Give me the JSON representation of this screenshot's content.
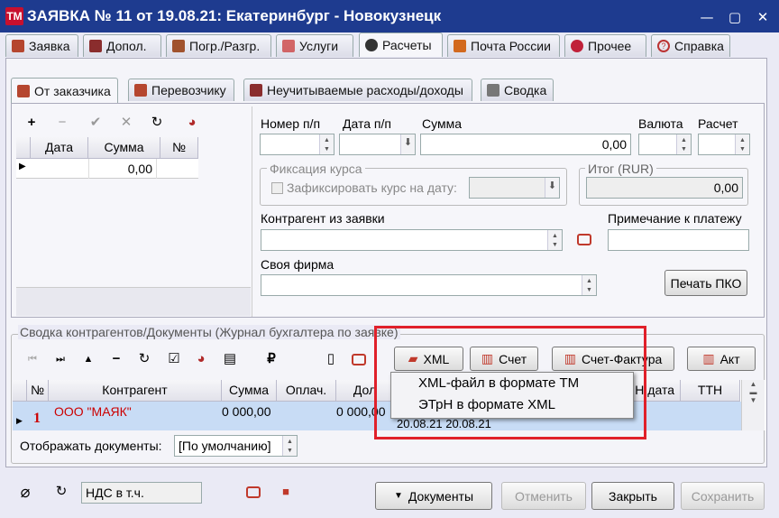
{
  "window": {
    "logo": "TM",
    "title": "ЗАЯВКА № 11 от 19.08.21: Екатеринбург - Новокузнецк",
    "min": "—",
    "max": "▢",
    "close": "✕"
  },
  "tabs": [
    {
      "label": "Заявка",
      "icon": "form-icon"
    },
    {
      "label": "Допол.",
      "icon": "puzzle-icon"
    },
    {
      "label": "Погр./Разгр.",
      "icon": "cargo-icon"
    },
    {
      "label": "Услуги",
      "icon": "table-icon"
    },
    {
      "label": "Расчеты",
      "icon": "wallet-icon",
      "active": true
    },
    {
      "label": "Почта России",
      "icon": "post-icon"
    },
    {
      "label": "Прочее",
      "icon": "hearts-icon"
    },
    {
      "label": "Справка",
      "icon": "help-icon"
    }
  ],
  "subtabs": [
    {
      "label": "От заказчика"
    },
    {
      "label": "Перевозчику"
    },
    {
      "label": "Неучитываемые расходы/доходы"
    },
    {
      "label": "Сводка"
    }
  ],
  "left_toolbar": [
    "+",
    "−",
    "✔",
    "✕",
    "↻",
    "◕"
  ],
  "left_grid": {
    "headers": [
      "Дата",
      "Сумма",
      "№"
    ],
    "row": {
      "date": "",
      "sum": "0,00",
      "num": ""
    }
  },
  "form": {
    "num_label": "Номер п/п",
    "date_label": "Дата п/п",
    "sum_label": "Сумма",
    "sum_value": "0,00",
    "currency_label": "Валюта",
    "calc_label": "Расчет",
    "fix_group": "Фиксация курса",
    "fix_check": "Зафиксировать курс на дату:",
    "total_group": "Итог (RUR)",
    "total_value": "0,00",
    "contractor_label": "Контрагент из заявки",
    "note_label": "Примечание к платежу",
    "firm_label": "Своя фирма",
    "print_btn": "Печать ПКО"
  },
  "summary": {
    "title": "Сводка контрагентов/Документы (Журнал бухгалтера по заявке)",
    "buttons": {
      "xml": "XML",
      "invoice": "Счет",
      "facture": "Счет-Фактура",
      "act": "Акт"
    },
    "headers": [
      "№",
      "Контрагент",
      "Сумма",
      "Оплач.",
      "Дол",
      "Н.дата",
      "ТТН"
    ],
    "row": {
      "num": "1",
      "contractor": "ООО \"МАЯК\"",
      "sum": "0 000,00",
      "debt": "0 000,00",
      "dates": "20.08.21 20.08.21"
    },
    "show_label": "Отображать документы:",
    "show_value": "[По умолчанию]"
  },
  "menu": {
    "items": [
      "XML-файл в формате ТМ",
      "ЭТрН в формате XML"
    ]
  },
  "footer": {
    "vat": "НДС в т.ч.",
    "docs": "Документы",
    "cancel": "Отменить",
    "close": "Закрыть",
    "save": "Сохранить"
  }
}
